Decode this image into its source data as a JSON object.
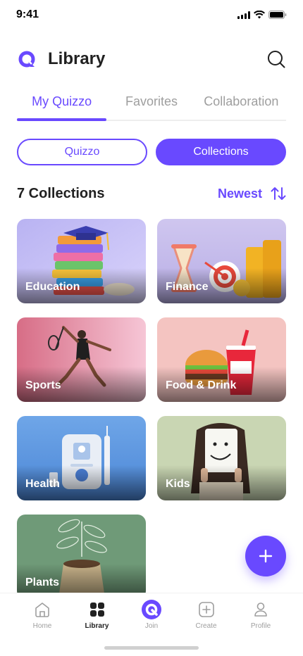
{
  "status_bar": {
    "time": "9:41"
  },
  "header": {
    "title": "Library"
  },
  "top_tabs": [
    {
      "label": "My Quizzo",
      "active": true
    },
    {
      "label": "Favorites",
      "active": false
    },
    {
      "label": "Collaboration",
      "active": false
    }
  ],
  "segment": {
    "left_label": "Quizzo",
    "right_label": "Collections",
    "selected": "Collections"
  },
  "collections_header": {
    "count_label": "7 Collections",
    "sort_label": "Newest"
  },
  "collections": [
    {
      "label": "Education"
    },
    {
      "label": "Finance"
    },
    {
      "label": "Sports"
    },
    {
      "label": "Food & Drink"
    },
    {
      "label": "Health"
    },
    {
      "label": "Kids"
    },
    {
      "label": "Plants"
    }
  ],
  "bottom_nav": [
    {
      "label": "Home",
      "icon": "home-icon",
      "active": false
    },
    {
      "label": "Library",
      "icon": "library-grid-icon",
      "active": true
    },
    {
      "label": "Join",
      "icon": "join-logo-icon",
      "active": false
    },
    {
      "label": "Create",
      "icon": "create-plus-icon",
      "active": false
    },
    {
      "label": "Profile",
      "icon": "profile-icon",
      "active": false
    }
  ],
  "colors": {
    "primary": "#6949ff",
    "text": "#212121",
    "muted": "#9e9e9e"
  }
}
